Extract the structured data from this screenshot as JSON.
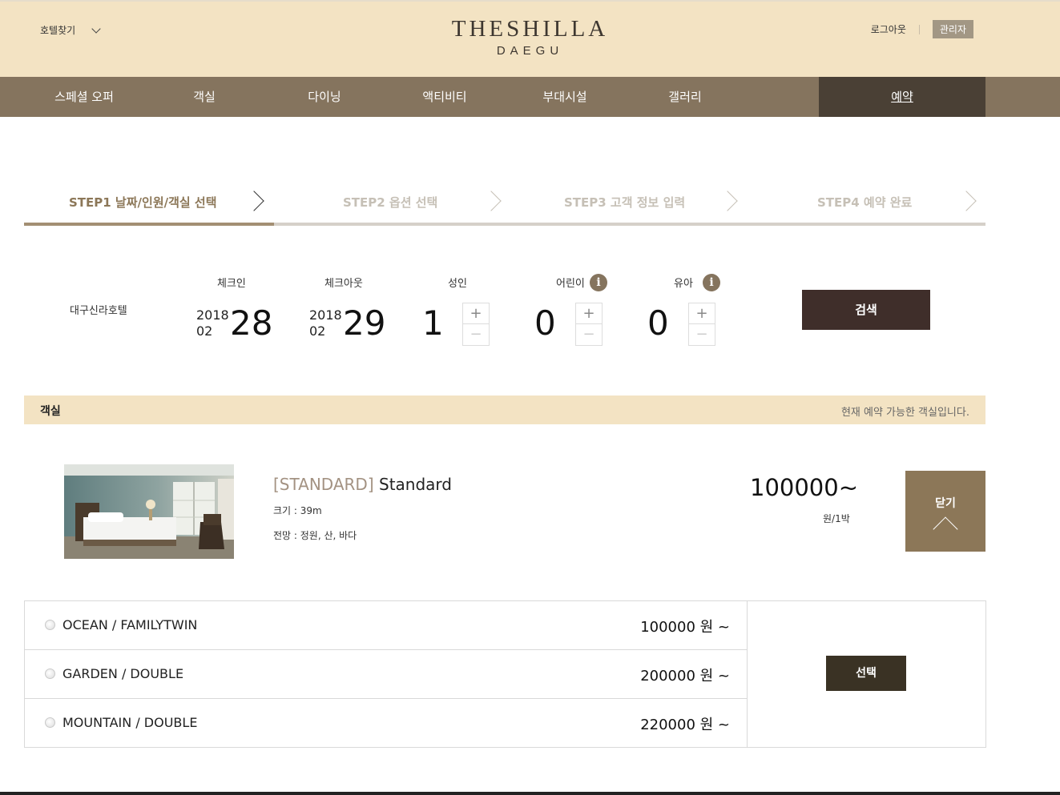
{
  "header": {
    "hotel_find": "호텔찾기",
    "logo_main": "THESHILLA",
    "logo_sub": "DAEGU",
    "logout": "로그아웃",
    "admin": "관리자"
  },
  "nav": {
    "items": [
      "스페셜 오퍼",
      "객실",
      "다이닝",
      "액티비티",
      "부대시설",
      "갤러리"
    ],
    "reserve": "예약"
  },
  "steps": [
    {
      "label": "STEP1 날짜/인원/객실 선택",
      "active": true
    },
    {
      "label": "STEP2 옵션 선택",
      "active": false
    },
    {
      "label": "STEP3 고객 정보 입력",
      "active": false
    },
    {
      "label": "STEP4 예약 완료",
      "active": false
    }
  ],
  "search": {
    "hotel": "대구신라호텔",
    "checkin_label": "체크인",
    "checkin_year": "2018",
    "checkin_month": "02",
    "checkin_day": "28",
    "checkout_label": "체크아웃",
    "checkout_year": "2018",
    "checkout_month": "02",
    "checkout_day": "29",
    "adult_label": "성인",
    "adult_count": "1",
    "child_label": "어린이",
    "child_count": "0",
    "infant_label": "유아",
    "infant_count": "0",
    "plus": "+",
    "minus": "−",
    "info": "i",
    "button": "검색"
  },
  "rooms_section": {
    "title": "객실",
    "note": "현재 예약 가능한 객실입니다."
  },
  "room": {
    "grade": "[STANDARD]",
    "name": "Standard",
    "size": "크기 : 39m",
    "view": "전망 : 정원, 산, 바다",
    "price": "100000~",
    "unit": "원/1박",
    "close": "닫기"
  },
  "options": [
    {
      "name": "OCEAN / FAMILYTWIN",
      "price": "100000 원 ~"
    },
    {
      "name": "GARDEN / DOUBLE",
      "price": "200000 원 ~"
    },
    {
      "name": "MOUNTAIN / DOUBLE",
      "price": "220000 원 ~"
    }
  ],
  "select_button": "선택",
  "colors": {
    "header_bg": "#f3e3c3",
    "nav_bg": "#85745e",
    "nav_active_bg": "#4a4035",
    "accent": "#8c7758",
    "search_button": "#3f2e2a",
    "select_button": "#3a3224"
  }
}
